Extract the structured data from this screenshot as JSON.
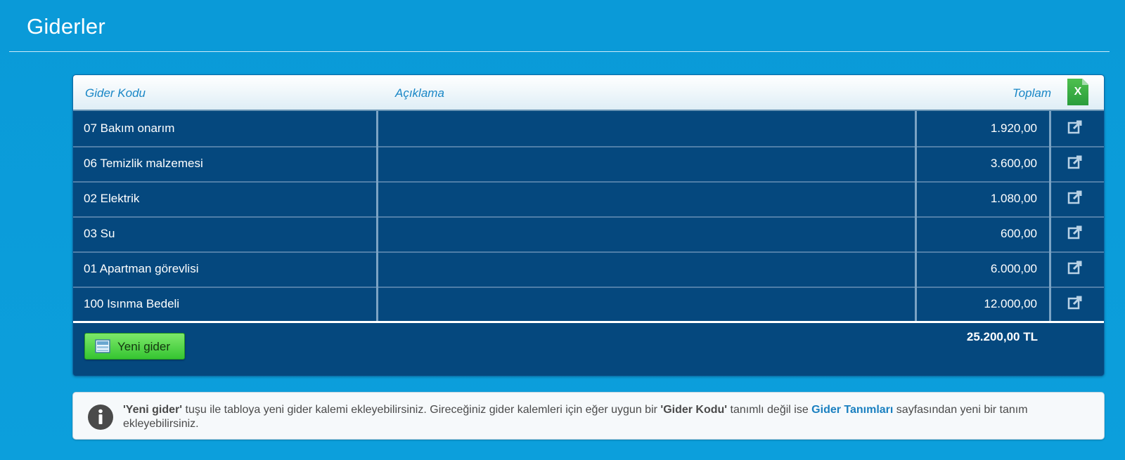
{
  "page": {
    "title": "Giderler"
  },
  "table": {
    "headers": {
      "code": "Gider Kodu",
      "description": "Açıklama",
      "total": "Toplam"
    },
    "excel_label": "X",
    "rows": [
      {
        "code": "07 Bakım onarım",
        "description": "",
        "total": "1.920,00"
      },
      {
        "code": "06 Temizlik malzemesi",
        "description": "",
        "total": "3.600,00"
      },
      {
        "code": "02 Elektrik",
        "description": "",
        "total": "1.080,00"
      },
      {
        "code": "03 Su",
        "description": "",
        "total": "600,00"
      },
      {
        "code": "01 Apartman görevlisi",
        "description": "",
        "total": "6.000,00"
      },
      {
        "code": "100 Isınma Bedeli",
        "description": "",
        "total": "12.000,00"
      }
    ],
    "grand_total": "25.200,00 TL",
    "new_button_label": "Yeni gider",
    "row_action_icon": "external-link-icon"
  },
  "info": {
    "icon": "info-icon",
    "part1": "'Yeni gider'",
    "part2": " tuşu ile tabloya yeni gider kalemi ekleyebilirsiniz. Gireceğiniz gider kalemleri için eğer uygun bir ",
    "part3": "'Gider Kodu'",
    "part4": " tanımlı değil ise ",
    "link": "Gider Tanımları",
    "part5": " sayfasından yeni bir tanım ekleyebilirsiniz."
  },
  "colors": {
    "background": "#0c9fdc",
    "table_body": "#05487e",
    "header_text": "#1a87c6",
    "button_green": "#35c531",
    "link": "#1a80c0"
  }
}
